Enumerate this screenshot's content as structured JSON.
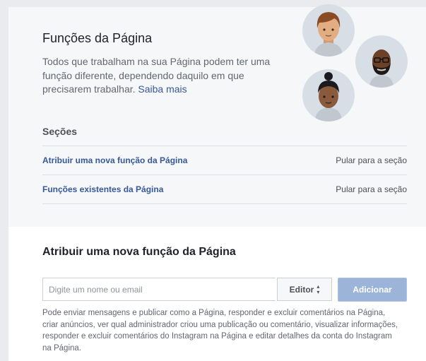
{
  "header": {
    "title": "Funções da Página",
    "intro_text": "Todos que trabalham na sua Página podem ter uma função diferente, dependendo daquilo em que precisarem trabalhar. ",
    "learn_more_link": "Saiba mais"
  },
  "sections": {
    "heading": "Seções",
    "items": [
      {
        "label": "Atribuir uma nova função da Página",
        "jump": "Pular para a seção"
      },
      {
        "label": "Funções existentes da Página",
        "jump": "Pular para a seção"
      }
    ]
  },
  "assign": {
    "title": "Atribuir uma nova função da Página",
    "input_placeholder": "Digite um nome ou email",
    "input_value": "",
    "role_selected": "Editor",
    "add_button": "Adicionar",
    "help_text": "Pode enviar mensagens e publicar como a Página, responder e excluir comentários na Página, criar anúncios, ver qual administrador criou uma publicação ou comentário, visualizar informações, responder e excluir comentários do Instagram na Página e editar detalhes da conta do Instagram na Página."
  },
  "colors": {
    "link": "#365899",
    "add_button_disabled": "#9cb4d8",
    "avatar_bg": "#d7dee5"
  },
  "icons": [
    "avatar-woman-icon",
    "avatar-bearded-man-icon",
    "avatar-woman-bun-icon",
    "updown-arrow-icon"
  ]
}
